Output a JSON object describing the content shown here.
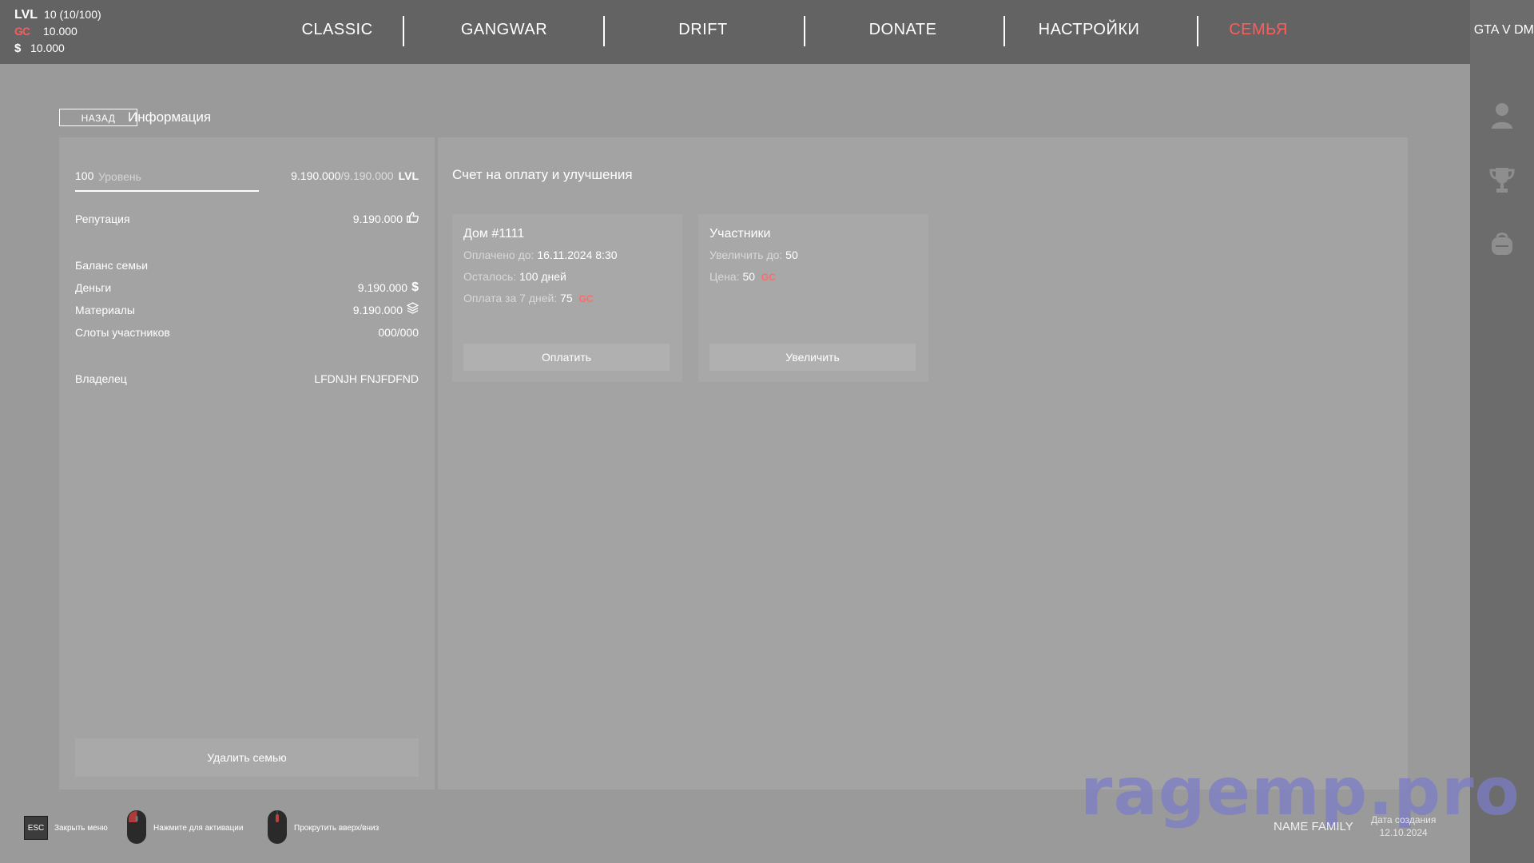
{
  "stats": {
    "lvl_label": "LVL",
    "lvl_value": "10 (10/100)",
    "gc_icon": "GC",
    "gc_value": "10.000",
    "usd_icon": "$",
    "usd_value": "10.000"
  },
  "nav": {
    "items": [
      "CLASSIC",
      "GANGWAR",
      "DRIFT",
      "DONATE",
      "НАСТРОЙКИ",
      "СЕМЬЯ"
    ],
    "active": "СЕМЬЯ",
    "accent_color": "#ff5c5c"
  },
  "brand": "GTA V DM",
  "right_sidebar": {
    "icons": [
      "user-icon",
      "trophy-icon",
      "backpack-icon"
    ]
  },
  "subheader": {
    "back_label": "НАЗАД",
    "title": "Информация"
  },
  "left_panel": {
    "level_num": "100",
    "level_label": "Уровень",
    "xp_current": "9.190.000",
    "xp_max": "/9.190.000",
    "xp_unit": "LVL",
    "reputation_label": "Репутация",
    "reputation_value": "9.190.000",
    "balance_label": "Баланс семьи",
    "money_label": "Деньги",
    "money_value": "9.190.000",
    "materials_label": "Материалы",
    "materials_value": "9.190.000",
    "slots_label": "Слоты участников",
    "slots_value": "000/000",
    "owner_label": "Владелец",
    "owner_value": "LFDNJH FNJFDFND",
    "delete_label": "Удалить семью"
  },
  "right_panel": {
    "title": "Счет на оплату и улучшения",
    "house_card": {
      "title": "Дом #1111",
      "paid_label": "Оплачено до:",
      "paid_value": "16.11.2024 8:30",
      "left_label": "Осталось:",
      "left_value": "100 дней",
      "pay7_label": "Оплата за 7 дней:",
      "pay7_value": "75",
      "currency": "GC",
      "button": "Оплатить"
    },
    "members_card": {
      "title": "Участники",
      "increase_label": "Увеличить до:",
      "increase_value": "50",
      "price_label": "Цена:",
      "price_value": "50",
      "currency": "GC",
      "button": "Увеличить"
    }
  },
  "footer": {
    "esc_key": "ESC",
    "close_hint": "Закрыть меню",
    "click_hint": "Нажмите для активации",
    "scroll_hint": "Прокрутить вверх/вниз",
    "family_name": "NAME FAMILY",
    "created_label": "Дата создания",
    "created_value": "12.10.2024",
    "watermark": "ragemp.pro"
  }
}
